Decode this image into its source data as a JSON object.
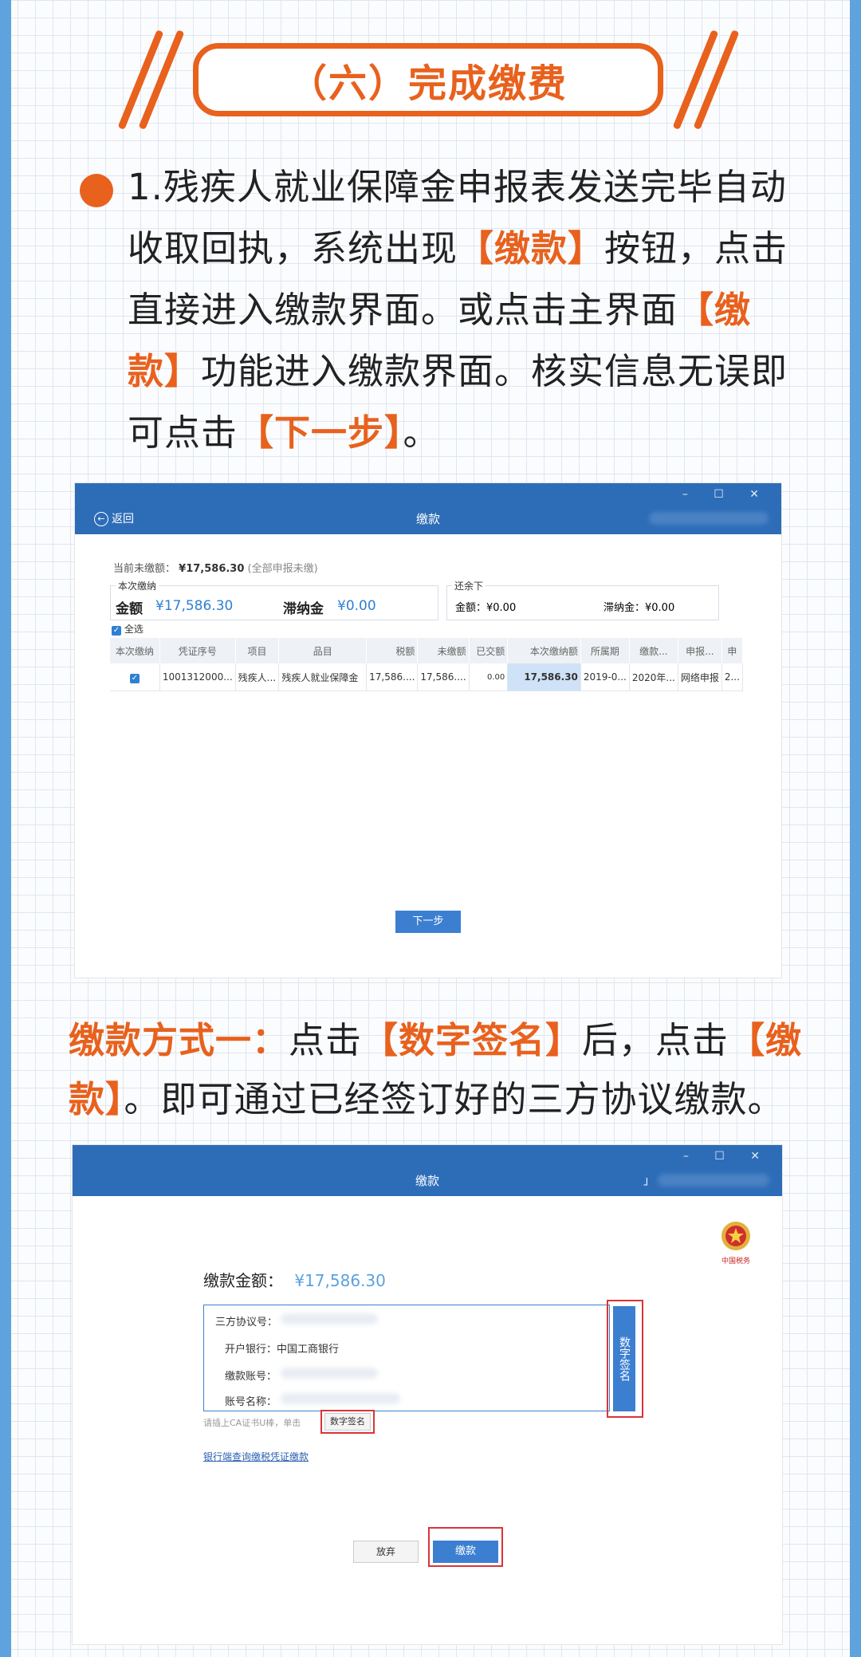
{
  "title": "（六）完成缴费",
  "para1": {
    "t1": "1.残疾人就业保障金申报表发送完毕自动收取回执，系统出现",
    "h1": "【缴款】",
    "t2": "按钮，点击直接进入缴款界面。或点击主界面",
    "h2": "【缴款】",
    "t3": "功能进入缴款界面。核实信息无误即可点击",
    "h3": "【下一步】",
    "t4": "。"
  },
  "para2": {
    "h0": "缴款方式一：",
    "t1": "点击",
    "h1": "【数字签名】",
    "t2": "后，点击",
    "h2": "【缴款】",
    "t3": "。即可通过已经签订好的三方协议缴款。"
  },
  "shot1": {
    "window_controls": "–  ☐  ✕",
    "back_label": "返回",
    "window_title": "缴款",
    "unpaid_label": "当前未缴额：",
    "unpaid_value": "¥17,586.30",
    "unpaid_note": "(全部申报未缴)",
    "this_payment_legend": "本次缴纳",
    "amount_label": "金额",
    "amount_value": "¥17,586.30",
    "late_fee_label": "滞纳金",
    "late_fee_value": "¥0.00",
    "remaining_legend": "还余下",
    "remaining_amount": "金额：¥0.00",
    "remaining_late_fee": "滞纳金：¥0.00",
    "select_all": "全选",
    "columns": [
      "本次缴纳",
      "凭证序号",
      "项目",
      "品目",
      "税额",
      "未缴额",
      "已交额",
      "本次缴纳额",
      "所属期",
      "缴款...",
      "申报...",
      "申"
    ],
    "row": [
      "✓",
      "1001312000...",
      "残疾人...",
      "残疾人就业保障金",
      "17,586....",
      "17,586....",
      "0.00",
      "17,586.30",
      "2019-0...",
      "2020年...",
      "网络申报",
      "2..."
    ],
    "next_button": "下一步"
  },
  "shot2": {
    "window_controls": "–  ☐  ✕",
    "window_title": "缴款",
    "title_mark": "」",
    "emblem_caption": "中国税务",
    "amount_label": "缴款金额：",
    "amount_value": "¥17,586.30",
    "agreement_label": "三方协议号：",
    "bank_label": "开户银行：",
    "bank_value": "中国工商银行",
    "account_label": "缴款账号：",
    "account_name_label": "账号名称：",
    "side_button": "数字签名",
    "hint": "请插上CA证书U棒，单击",
    "sign_button": "数字签名",
    "bank_link": "银行端查询缴税凭证缴款",
    "abandon_button": "放弃",
    "pay_button": "缴款"
  },
  "colors": {
    "accent_orange": "#e8611d",
    "titlebar_blue": "#2d6db8",
    "highlight_red": "#d9343a"
  }
}
